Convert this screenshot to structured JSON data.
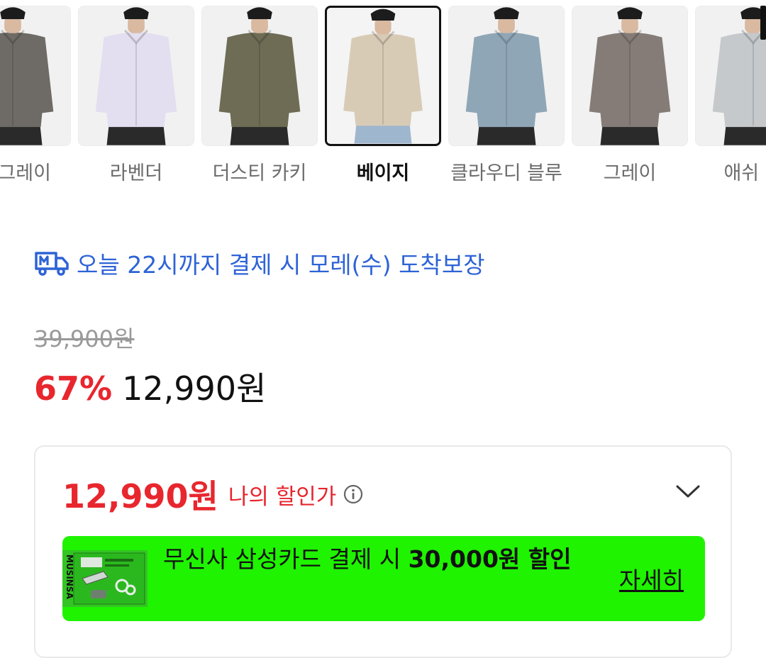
{
  "colors": {
    "accent_red": "#e8262e",
    "delivery_blue": "#2e63d6",
    "promo_green": "#1ff300"
  },
  "color_options": [
    {
      "label": "엄 그레이",
      "shirt_color": "#6e6b66",
      "selected": false
    },
    {
      "label": "라벤더",
      "shirt_color": "#e3def0",
      "selected": false
    },
    {
      "label": "더스티 카키",
      "shirt_color": "#6e6c55",
      "selected": false
    },
    {
      "label": "베이지",
      "shirt_color": "#d8cbb6",
      "selected": true
    },
    {
      "label": "클라우디 블루",
      "shirt_color": "#8fa6b6",
      "selected": false
    },
    {
      "label": "그레이",
      "shirt_color": "#857c78",
      "selected": false
    },
    {
      "label": "애쉬 그",
      "shirt_color": "#c5c9cc",
      "selected": false
    }
  ],
  "delivery": {
    "icon": "m-delivery-truck-icon",
    "text": "오늘 22시까지 결제 시 모레(수) 도착보장"
  },
  "price": {
    "original": "39,900원",
    "discount_rate": "67%",
    "sale": "12,990원"
  },
  "my_discount": {
    "price": "12,990원",
    "label": "나의 할인가",
    "info_icon": "info-icon",
    "toggle_icon": "chevron-down-icon"
  },
  "promo": {
    "text_prefix": "무신사 삼성카드 결제 시 ",
    "amount": "30,000원",
    "text_suffix": " 할인",
    "details_link": "자세히",
    "card_brand": "MUSINSA"
  }
}
